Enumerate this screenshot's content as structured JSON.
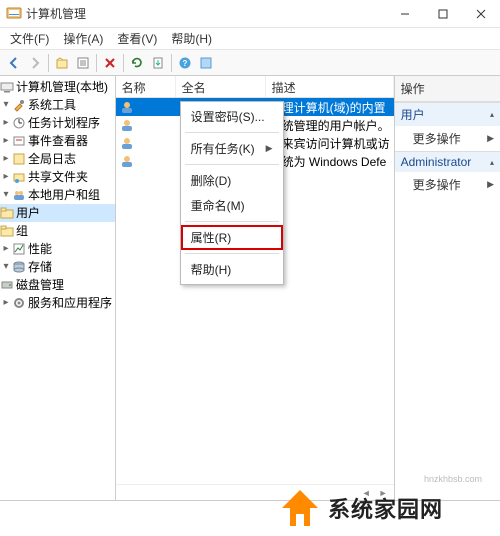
{
  "window": {
    "title": "计算机管理",
    "buttons": {
      "min": "—",
      "max": "▢",
      "close": "✕"
    }
  },
  "menubar": {
    "file": "文件(F)",
    "action": "操作(A)",
    "view": "查看(V)",
    "help": "帮助(H)"
  },
  "tree": {
    "root": "计算机管理(本地)",
    "system_tools": "系统工具",
    "task_scheduler": "任务计划程序",
    "event_viewer": "事件查看器",
    "global_log": "全局日志",
    "shared_folders": "共享文件夹",
    "local_users_groups": "本地用户和组",
    "users": "用户",
    "groups": "组",
    "performance": "性能",
    "storage": "存储",
    "disk_mgmt": "磁盘管理",
    "services_apps": "服务和应用程序"
  },
  "list": {
    "head_name": "名称",
    "head_full": "全名",
    "head_desc": "描述",
    "rows": [
      {
        "name": "",
        "full": "",
        "desc": "管理计算机(域)的内置"
      },
      {
        "name": "",
        "full": "",
        "desc": "系统管理的用户帐户。"
      },
      {
        "name": "",
        "full": "",
        "desc": "供来宾访问计算机或访"
      },
      {
        "name": "",
        "full": "",
        "desc": "系统为 Windows Defe"
      }
    ]
  },
  "context_menu": {
    "set_pwd": "设置密码(S)...",
    "all_tasks": "所有任务(K)",
    "delete": "删除(D)",
    "rename": "重命名(M)",
    "properties": "属性(R)",
    "help": "帮助(H)"
  },
  "actions": {
    "title": "操作",
    "sec1": "用户",
    "more1": "更多操作",
    "sec2": "Administrator",
    "more2": "更多操作"
  },
  "watermark": {
    "text": "系统家园网",
    "sub": "hnzkhbsb.com"
  }
}
